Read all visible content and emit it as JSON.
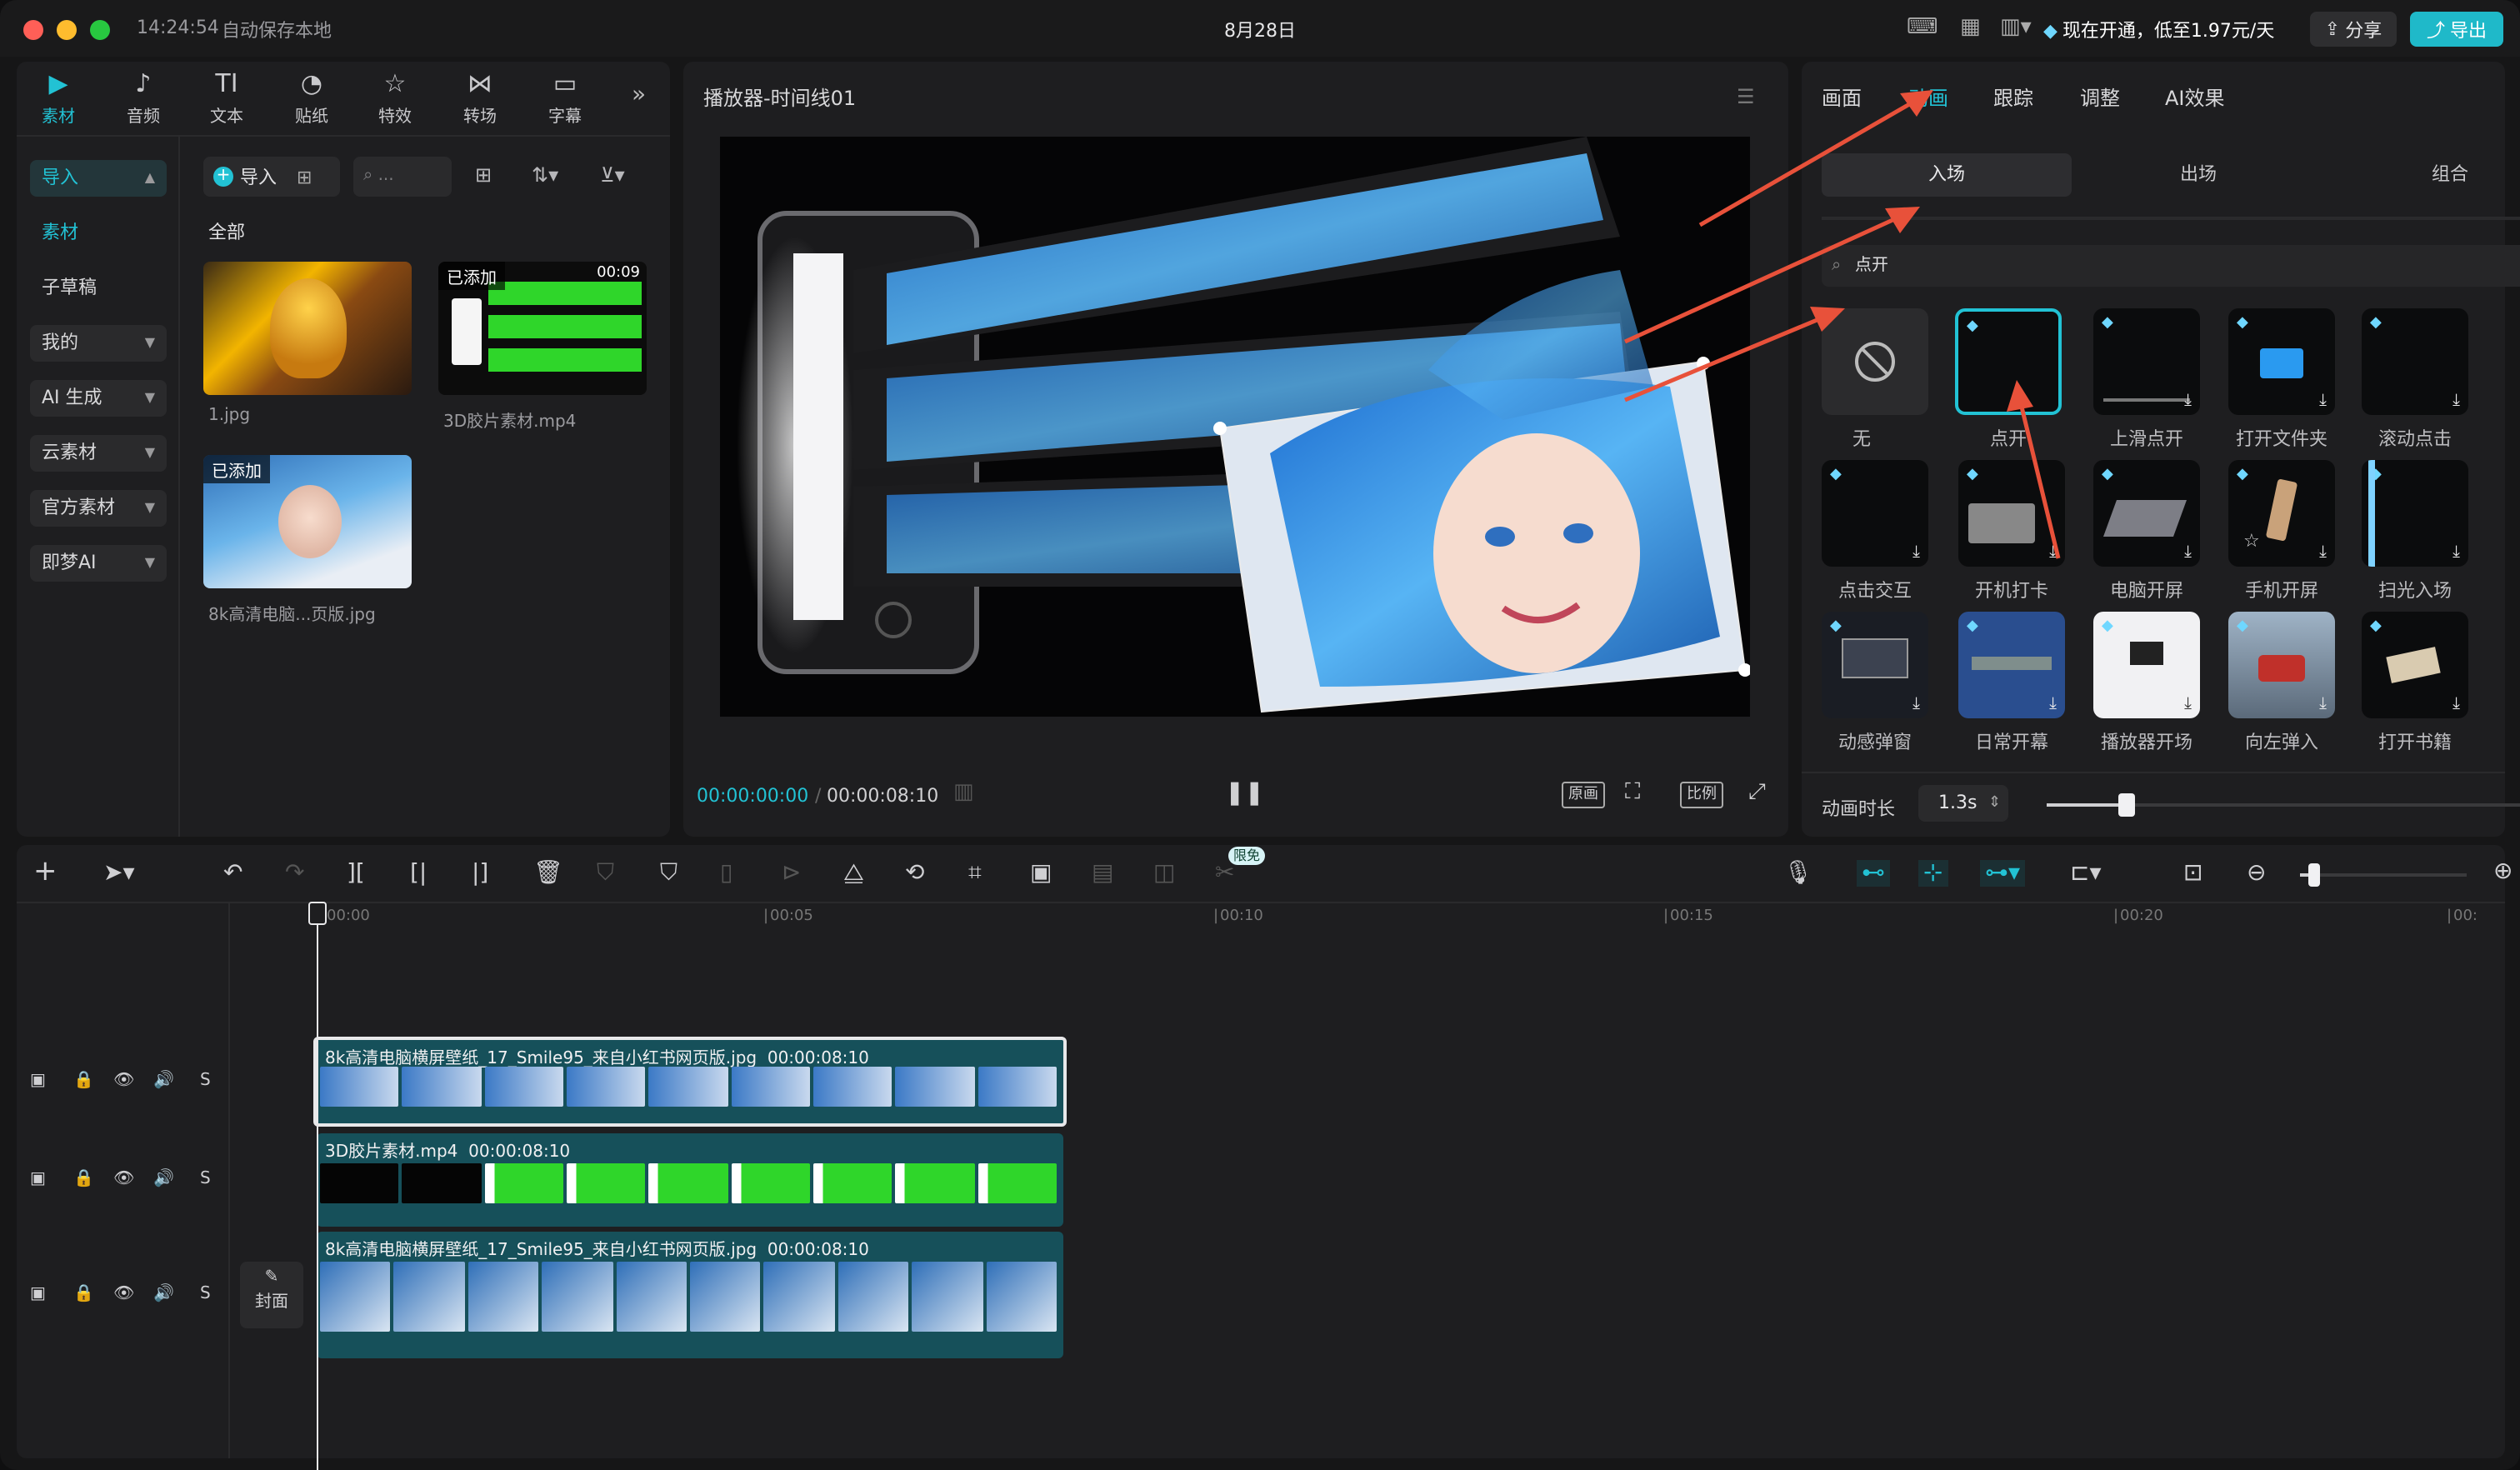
{
  "titlebar": {
    "time": "14:24:54",
    "autosave": "自动保存本地",
    "date": "8月28日",
    "vip_text": "现在开通，低至1.97元/天",
    "share_label": "分享",
    "export_label": "导出"
  },
  "media": {
    "tabs": [
      {
        "label": "素材",
        "icon": "media-icon"
      },
      {
        "label": "音频",
        "icon": "audio-icon"
      },
      {
        "label": "文本",
        "icon": "text-icon"
      },
      {
        "label": "贴纸",
        "icon": "sticker-icon"
      },
      {
        "label": "特效",
        "icon": "effects-icon"
      },
      {
        "label": "转场",
        "icon": "transition-icon"
      },
      {
        "label": "字幕",
        "icon": "caption-icon"
      }
    ],
    "sidebar": [
      "导入",
      "素材",
      "子草稿",
      "我的",
      "AI 生成",
      "云素材",
      "官方素材",
      "即梦AI"
    ],
    "import_label": "导入",
    "search_placeholder": "...",
    "all_label": "全部",
    "items": [
      {
        "name": "1.jpg",
        "added": ""
      },
      {
        "name": "3D胶片素材.mp4",
        "added": "已添加",
        "duration": "00:09"
      },
      {
        "name": "8k高清电脑...页版.jpg",
        "added": "已添加"
      }
    ]
  },
  "player": {
    "title": "播放器-时间线01",
    "current_time": "00:00:00:00",
    "total_time": "00:00:08:10",
    "btn_original": "原画",
    "btn_ratio": "比例"
  },
  "props": {
    "tabs": [
      "画面",
      "动画",
      "跟踪",
      "调整",
      "AI效果"
    ],
    "subtabs": [
      "入场",
      "出场",
      "组合"
    ],
    "search_value": "点开",
    "effects": [
      "无",
      "点开",
      "上滑点开",
      "打开文件夹",
      "滚动点击",
      "点击交互",
      "开机打卡",
      "电脑开屏",
      "手机开屏",
      "扫光入场",
      "动感弹窗",
      "日常开幕",
      "播放器开场",
      "向左弹入",
      "打开书籍"
    ],
    "duration_label": "动画时长",
    "duration_value": "1.3s",
    "duration_fraction": 0.15
  },
  "timeline": {
    "limited_badge": "限免",
    "ruler": [
      "00:00",
      "00:05",
      "00:10",
      "00:15",
      "00:20",
      "00:"
    ],
    "tracks": [
      {
        "title": "8k高清电脑横屏壁纸_17_Smile95_来自小红书网页版.jpg",
        "duration": "00:00:08:10"
      },
      {
        "title": "3D胶片素材.mp4",
        "duration": "00:00:08:10"
      },
      {
        "title": "8k高清电脑横屏壁纸_17_Smile95_来自小红书网页版.jpg",
        "duration": "00:00:08:10"
      }
    ],
    "cover_label": "封面",
    "track_solo": "S"
  },
  "colors": {
    "accent": "#22c2d4",
    "arrow": "#e8513a",
    "green": "#2fd62a"
  }
}
